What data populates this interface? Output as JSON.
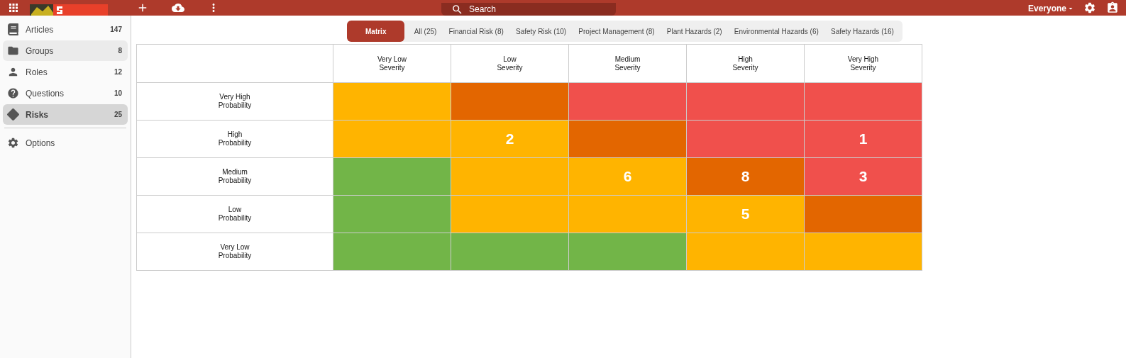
{
  "top_bar": {
    "search": {
      "placeholder": "Search"
    },
    "audience": "Everyone"
  },
  "sidebar": {
    "items": [
      {
        "label": "Articles",
        "count": "147",
        "selected": false,
        "hovered": false
      },
      {
        "label": "Groups",
        "count": "8",
        "selected": false,
        "hovered": true
      },
      {
        "label": "Roles",
        "count": "12",
        "selected": false,
        "hovered": false
      },
      {
        "label": "Questions",
        "count": "10",
        "selected": false,
        "hovered": false
      },
      {
        "label": "Risks",
        "count": "25",
        "selected": true,
        "hovered": false
      }
    ],
    "options": {
      "label": "Options"
    }
  },
  "tabs": [
    {
      "label": "Matrix",
      "selected": true
    },
    {
      "label": "All (25)",
      "selected": false
    },
    {
      "label": "Financial Risk (8)",
      "selected": false
    },
    {
      "label": "Safety Risk (10)",
      "selected": false
    },
    {
      "label": "Project Management (8)",
      "selected": false
    },
    {
      "label": "Plant Hazards (2)",
      "selected": false
    },
    {
      "label": "Environmental Hazards (6)",
      "selected": false
    },
    {
      "label": "Safety Hazards (16)",
      "selected": false
    }
  ],
  "matrix": {
    "columns": [
      "Very Low\nSeverity",
      "Low\nSeverity",
      "Medium\nSeverity",
      "High\nSeverity",
      "Very High\nSeverity"
    ],
    "rows": [
      {
        "label": "Very High\nProbability",
        "cells": [
          {
            "color": "#ffb400"
          },
          {
            "color": "#e36600"
          },
          {
            "color": "#f0504c"
          },
          {
            "color": "#f0504c"
          },
          {
            "color": "#f0504c"
          }
        ]
      },
      {
        "label": "High\nProbability",
        "cells": [
          {
            "color": "#ffb400"
          },
          {
            "color": "#ffb400",
            "count": "2"
          },
          {
            "color": "#e36600"
          },
          {
            "color": "#f0504c"
          },
          {
            "color": "#f0504c",
            "count": "1"
          }
        ]
      },
      {
        "label": "Medium\nProbability",
        "cells": [
          {
            "color": "#72b548"
          },
          {
            "color": "#ffb400"
          },
          {
            "color": "#ffb400",
            "count": "6"
          },
          {
            "color": "#e36600",
            "count": "8"
          },
          {
            "color": "#f0504c",
            "count": "3"
          }
        ]
      },
      {
        "label": "Low\nProbability",
        "cells": [
          {
            "color": "#72b548"
          },
          {
            "color": "#ffb400"
          },
          {
            "color": "#ffb400"
          },
          {
            "color": "#ffb400",
            "count": "5"
          },
          {
            "color": "#e36600"
          }
        ]
      },
      {
        "label": "Very Low\nProbability",
        "cells": [
          {
            "color": "#72b548"
          },
          {
            "color": "#72b548"
          },
          {
            "color": "#72b548"
          },
          {
            "color": "#ffb400"
          },
          {
            "color": "#ffb400"
          }
        ]
      }
    ]
  }
}
